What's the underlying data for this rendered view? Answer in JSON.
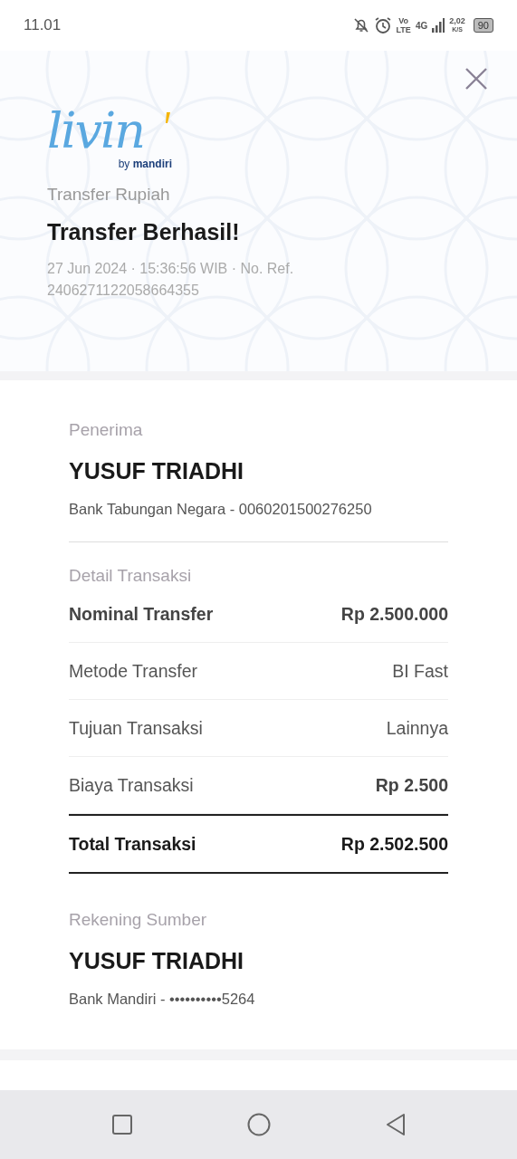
{
  "status_bar": {
    "time": "11.01",
    "volte_top": "Vo",
    "volte_bottom": "LTE",
    "network": "4G",
    "speed": "2,02",
    "speed_unit": "K/S",
    "battery": "90"
  },
  "logo": {
    "wordmark": "livin",
    "byline_prefix": "by",
    "byline_brand": "mandiri"
  },
  "header": {
    "category": "Transfer Rupiah",
    "title": "Transfer Berhasil!",
    "meta": "27 Jun 2024 · 15:36:56 WIB · No. Ref. 2406271122058664355"
  },
  "recipient": {
    "section_label": "Penerima",
    "name": "YUSUF TRIADHI",
    "account": "Bank Tabungan Negara - 0060201500276250"
  },
  "details": {
    "section_label": "Detail Transaksi",
    "rows": [
      {
        "kind": "bold",
        "label": "Nominal Transfer",
        "value": "Rp 2.500.000"
      },
      {
        "kind": "plain",
        "label": "Metode Transfer",
        "value": "BI Fast"
      },
      {
        "kind": "plain",
        "label": "Tujuan Transaksi",
        "value": "Lainnya"
      },
      {
        "kind": "fee",
        "label": "Biaya Transaksi",
        "value": "Rp 2.500"
      },
      {
        "kind": "total",
        "label": "Total Transaksi",
        "value": "Rp 2.502.500"
      }
    ]
  },
  "source": {
    "section_label": "Rekening Sumber",
    "name": "YUSUF TRIADHI",
    "account": "Bank Mandiri - ••••••••••5264"
  }
}
